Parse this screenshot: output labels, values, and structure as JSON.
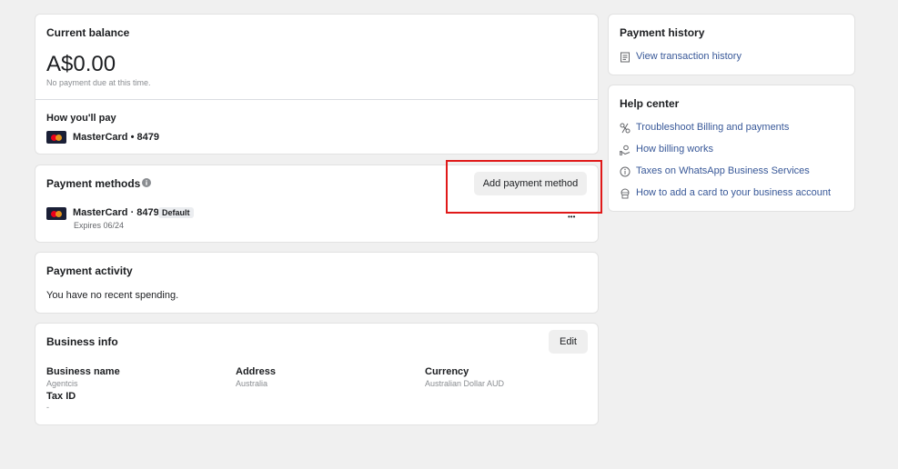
{
  "balance": {
    "title": "Current balance",
    "amount": "A$0.00",
    "note": "No payment due at this time.",
    "how_pay_label": "How you'll pay",
    "card_label": "MasterCard • 8479"
  },
  "payment_methods": {
    "title": "Payment methods",
    "add_button": "Add payment method",
    "card_label": "MasterCard · 8479",
    "default_badge": "Default",
    "expires": "Expires 06/24",
    "more_glyph": "•••"
  },
  "activity": {
    "title": "Payment activity",
    "message": "You have no recent spending."
  },
  "business": {
    "title": "Business info",
    "edit_button": "Edit",
    "name_label": "Business name",
    "name_value": "Agentcis",
    "address_label": "Address",
    "address_value": "Australia",
    "currency_label": "Currency",
    "currency_value": "Australian Dollar AUD",
    "tax_label": "Tax ID",
    "tax_value": "-"
  },
  "history": {
    "title": "Payment history",
    "link": "View transaction history"
  },
  "help": {
    "title": "Help center",
    "links": [
      {
        "label": "Troubleshoot Billing and payments",
        "icon": "tools-icon"
      },
      {
        "label": "How billing works",
        "icon": "billing-hand-icon"
      },
      {
        "label": "Taxes on WhatsApp Business Services",
        "icon": "info-icon"
      },
      {
        "label": "How to add a card to your business account",
        "icon": "globe-card-icon"
      }
    ]
  },
  "colors": {
    "link": "#385898",
    "highlight": "#e01919",
    "background": "#f0f0f0"
  }
}
